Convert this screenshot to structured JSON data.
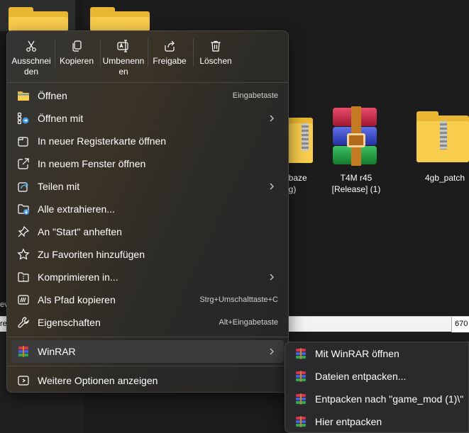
{
  "background": {
    "files": [
      {
        "label_line1": "_baze",
        "label_line2": "ng)"
      },
      {
        "label_line1": "T4M r45",
        "label_line2": "[Release] (1)"
      },
      {
        "label_line1": "4gb_patch",
        "label_line2": ""
      }
    ],
    "statusbar_left": "re",
    "statusbar_right": "670",
    "side_text": "ev"
  },
  "quick_actions": [
    {
      "label": "Ausschnei\nden",
      "icon": "scissors-icon"
    },
    {
      "label": "Kopieren",
      "icon": "copy-icon"
    },
    {
      "label": "Umbenenn\nen",
      "icon": "rename-icon"
    },
    {
      "label": "Freigabe",
      "icon": "share-icon"
    },
    {
      "label": "Löschen",
      "icon": "trash-icon"
    }
  ],
  "menu_items": [
    {
      "label": "Öffnen",
      "shortcut": "Eingabetaste",
      "icon": "folder-open-icon"
    },
    {
      "label": "Öffnen mit",
      "shortcut": "",
      "icon": "open-with-icon",
      "submenu": true
    },
    {
      "label": "In neuer Registerkarte öffnen",
      "shortcut": "",
      "icon": "new-tab-icon"
    },
    {
      "label": "In neuem Fenster öffnen",
      "shortcut": "",
      "icon": "new-window-icon"
    },
    {
      "label": "Teilen mit",
      "shortcut": "",
      "icon": "share-with-icon",
      "submenu": true
    },
    {
      "label": "Alle extrahieren...",
      "shortcut": "",
      "icon": "extract-all-icon"
    },
    {
      "label": "An \"Start\" anheften",
      "shortcut": "",
      "icon": "pin-icon"
    },
    {
      "label": "Zu Favoriten hinzufügen",
      "shortcut": "",
      "icon": "star-icon"
    },
    {
      "label": "Komprimieren in...",
      "shortcut": "",
      "icon": "compress-icon",
      "submenu": true
    },
    {
      "label": "Als Pfad kopieren",
      "shortcut": "Strg+Umschalttaste+C",
      "icon": "copy-path-icon"
    },
    {
      "label": "Eigenschaften",
      "shortcut": "Alt+Eingabetaste",
      "icon": "wrench-icon"
    }
  ],
  "winrar_item": {
    "label": "WinRAR",
    "icon": "winrar-icon"
  },
  "more_options": {
    "label": "Weitere Optionen anzeigen",
    "icon": "more-options-icon"
  },
  "winrar_submenu": [
    {
      "label": "Mit WinRAR öffnen"
    },
    {
      "label": "Dateien entpacken..."
    },
    {
      "label": "Entpacken nach \"game_mod (1)\\\""
    },
    {
      "label": "Hier entpacken"
    }
  ],
  "colors": {
    "accent": "#60cdff",
    "folder": "#f8cd4c",
    "menu_bg": "#2c2c2c"
  }
}
